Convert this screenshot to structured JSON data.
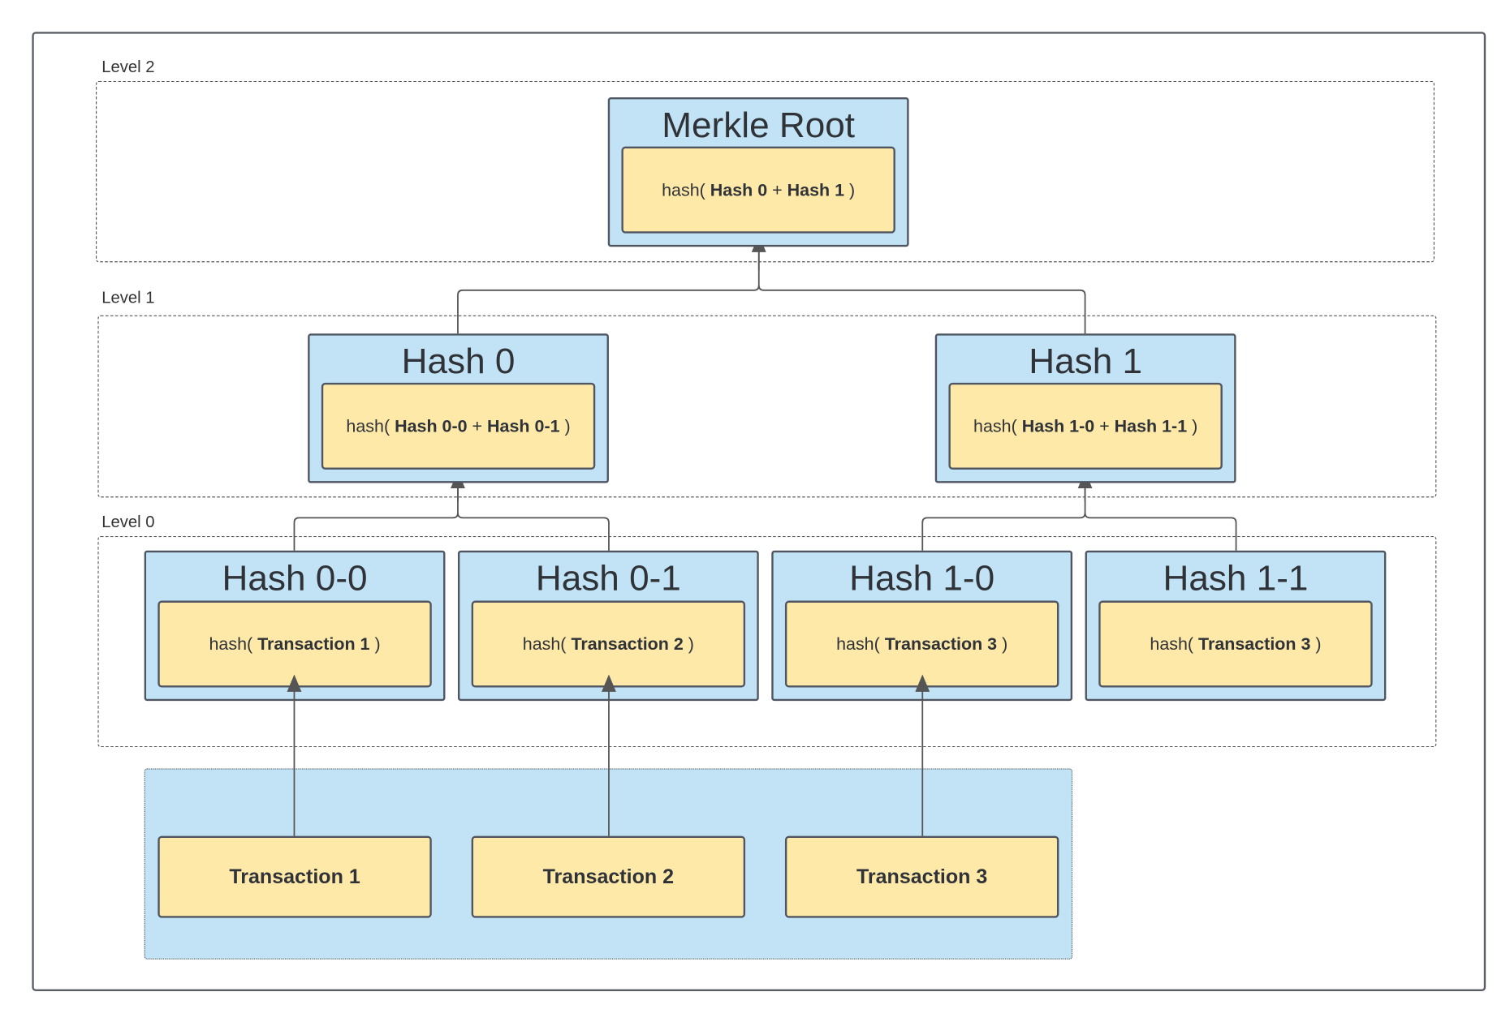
{
  "levels": {
    "level2": "Level 2",
    "level1": "Level 1",
    "level0": "Level 0"
  },
  "root": {
    "title": "Merkle Root",
    "fn": "hash(",
    "a": "Hash 0",
    "op": "+",
    "b": "Hash 1",
    "close": ")"
  },
  "level1": [
    {
      "title": "Hash 0",
      "fn": "hash(",
      "a": "Hash 0-0",
      "op": "+",
      "b": "Hash 0-1",
      "close": ")"
    },
    {
      "title": "Hash 1",
      "fn": "hash(",
      "a": "Hash 1-0",
      "op": "+",
      "b": "Hash 1-1",
      "close": ")"
    }
  ],
  "level0": [
    {
      "title": "Hash 0-0",
      "fn": "hash(",
      "a": "Transaction 1",
      "close": ")"
    },
    {
      "title": "Hash 0-1",
      "fn": "hash(",
      "a": "Transaction 2",
      "close": ")"
    },
    {
      "title": "Hash 1-0",
      "fn": "hash(",
      "a": "Transaction 3",
      "close": ")"
    },
    {
      "title": "Hash 1-1",
      "fn": "hash(",
      "a": "Transaction 3",
      "close": ")"
    }
  ],
  "transactions": [
    "Transaction 1",
    "Transaction 2",
    "Transaction 3"
  ],
  "colors": {
    "node": "#c2e3f6",
    "hash_box": "#ffe9a8",
    "border": "#4f5661"
  }
}
